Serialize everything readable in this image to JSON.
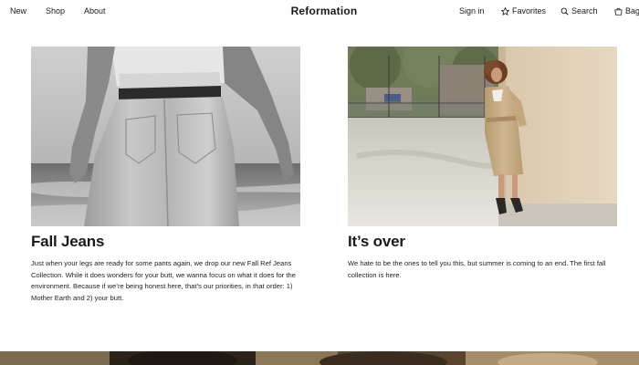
{
  "header": {
    "nav_left": [
      "New",
      "Shop",
      "About"
    ],
    "logo": "Reformation",
    "sign_in": "Sign in",
    "favorites": "Favorites",
    "search": "Search",
    "bag": "Bag"
  },
  "cards": [
    {
      "title": "Fall Jeans",
      "text": "Just when your legs are ready for some pants again, we drop our new Fall Ref Jeans Collection. While it does wonders for your butt, we wanna focus on what it does for the environment. Because if we’re being honest here, that’s our priorities, in that order: 1) Mother Earth and 2) your butt."
    },
    {
      "title": "It’s over",
      "text": "We hate to be the ones to tell you this, but summer is coming to an end. The first fall collection is here."
    }
  ],
  "colors": {
    "text": "#1a1a1a",
    "background": "#ffffff"
  },
  "icons": [
    "star-icon",
    "search-icon",
    "bag-icon"
  ]
}
